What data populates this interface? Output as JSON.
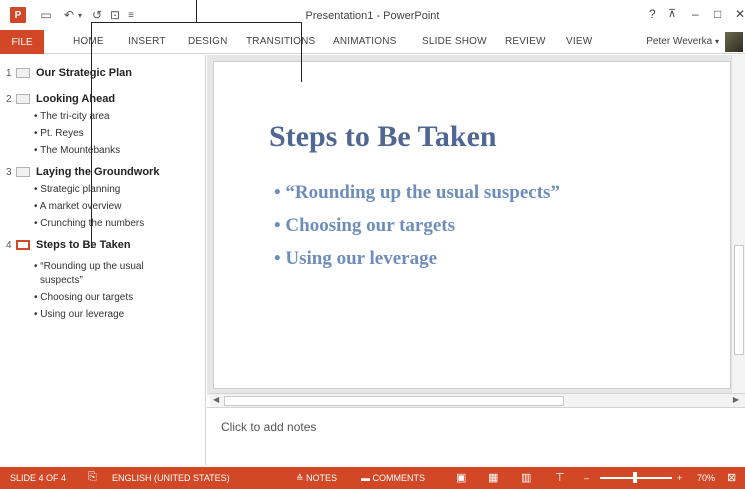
{
  "window": {
    "title": "Presentation1 - PowerPoint",
    "help": "?",
    "minimize": "–",
    "maximize": "□",
    "close": "✕"
  },
  "quick_access": {
    "app_icon": "powerpoint-logo",
    "app_letter": "P",
    "save": "💾",
    "undo": "↶",
    "undo_caret": "▾",
    "redo": "↺",
    "start": "⊡",
    "customize": "≡"
  },
  "ribbon": {
    "tabs": [
      "FILE",
      "HOME",
      "INSERT",
      "DESIGN",
      "TRANSITIONS",
      "ANIMATIONS",
      "SLIDE SHOW",
      "REVIEW",
      "VIEW"
    ],
    "user": "Peter Weverka",
    "user_caret": "▾"
  },
  "outline": {
    "slides": [
      {
        "num": "1",
        "title": "Our Strategic Plan",
        "bullets": []
      },
      {
        "num": "2",
        "title": "Looking Ahead",
        "bullets": [
          "The tri-city area",
          "Pt. Reyes",
          "The Mountebanks"
        ]
      },
      {
        "num": "3",
        "title": "Laying the Groundwork",
        "bullets": [
          "Strategic planning",
          "A market overview",
          "Crunching the numbers"
        ]
      },
      {
        "num": "4",
        "title": "Steps to Be Taken",
        "bullets": [
          "“Rounding up the usual",
          "suspects”",
          "Choosing our targets",
          "Using our leverage"
        ]
      }
    ]
  },
  "slide": {
    "heading": "Steps to Be Taken",
    "bullets": [
      "• “Rounding up the usual suspects”",
      "• Choosing our targets",
      "• Using our leverage"
    ]
  },
  "notes": {
    "placeholder": "Click to add notes"
  },
  "status": {
    "slide_info": "SLIDE 4 OF 4",
    "language": "ENGLISH (UNITED STATES)",
    "notes": "NOTES",
    "comments": "COMMENTS",
    "zoom": "70%",
    "zoom_minus": "–",
    "zoom_plus": "+"
  }
}
